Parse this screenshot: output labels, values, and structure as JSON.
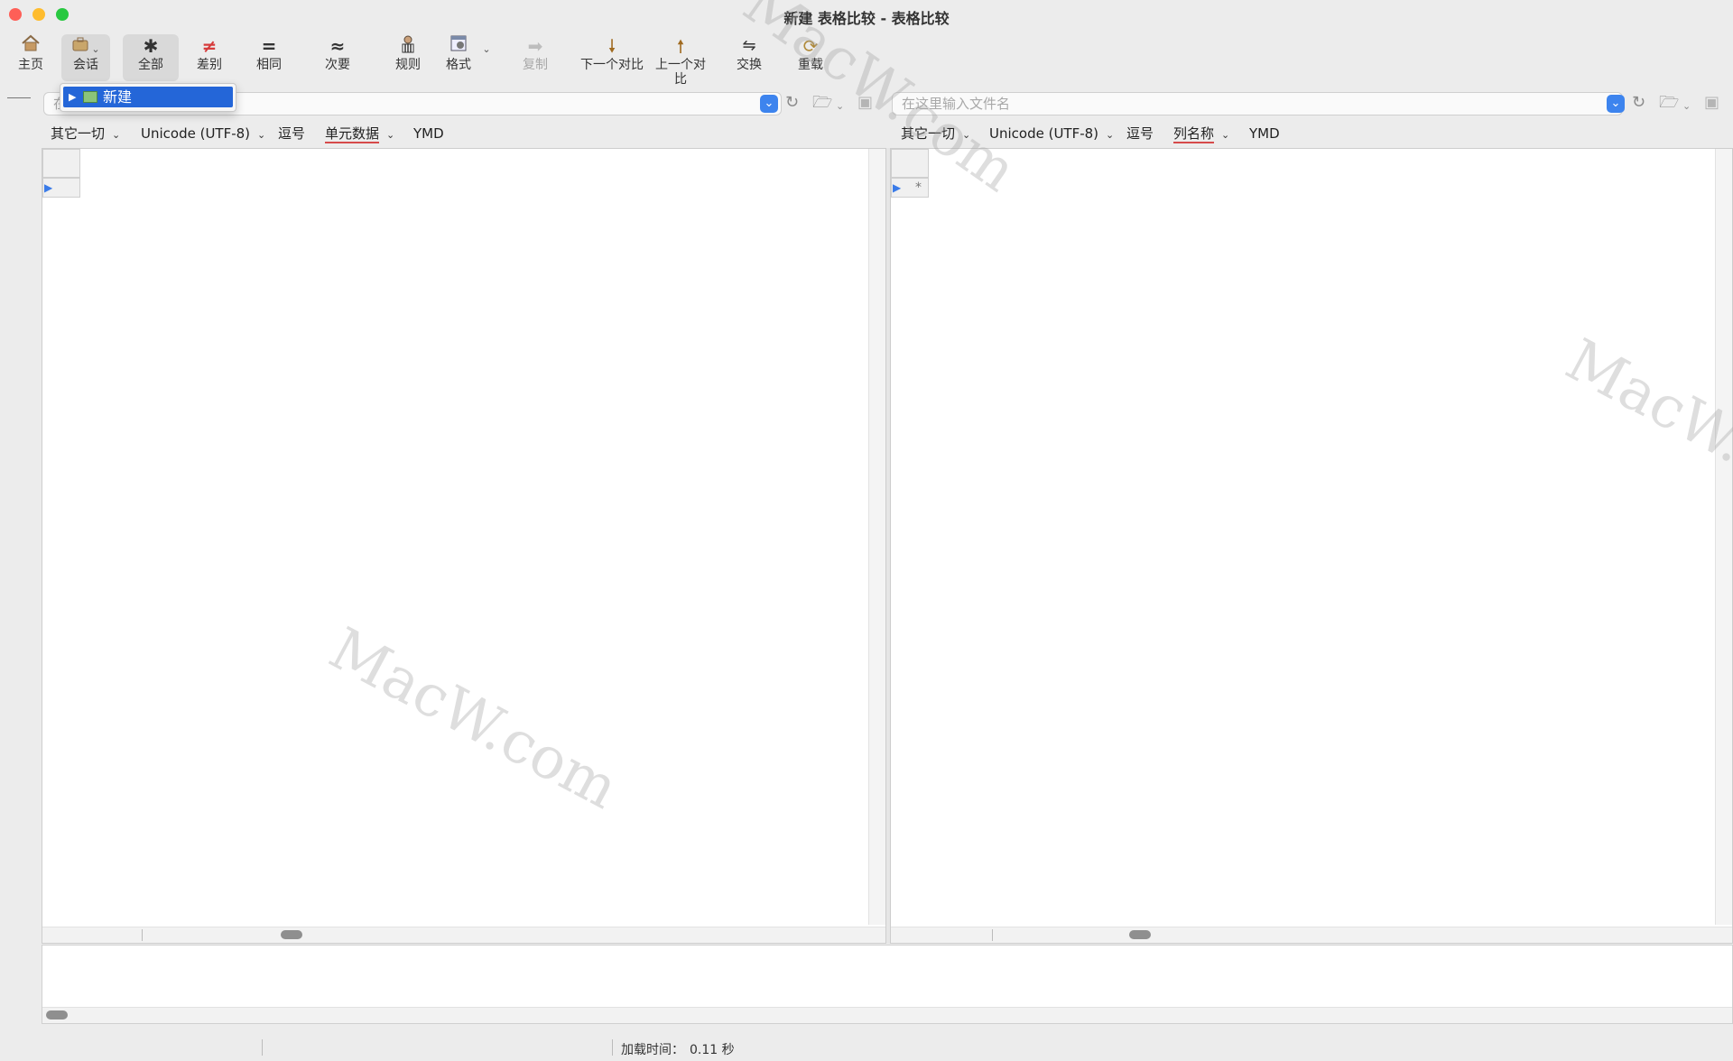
{
  "window": {
    "title": "新建 表格比较 - 表格比较"
  },
  "toolbar": {
    "home": "主页",
    "session": "会话",
    "all": "全部",
    "diffs": "差别",
    "same": "相同",
    "minor": "次要",
    "rules": "规则",
    "format": "格式",
    "copy": "复制",
    "next_diff": "下一个对比",
    "prev_diff": "上一个对比",
    "swap": "交换",
    "reload": "重载"
  },
  "session_menu": {
    "item": "新建"
  },
  "left": {
    "path_placeholder": "在这里输入文件名",
    "options": [
      "其它一切",
      "Unicode (UTF-8)",
      "逗号",
      "单元数据",
      "YMD"
    ]
  },
  "right": {
    "path_placeholder": "在这里输入文件名",
    "options": [
      "其它一切",
      "Unicode (UTF-8)",
      "逗号",
      "列名称",
      "YMD"
    ],
    "new_row_marker": "*"
  },
  "status": {
    "label": "加载时间：",
    "value": "0.11 秒"
  },
  "watermark": "MacW.com",
  "colors": {
    "accent": "#3d84ee",
    "selection": "#2466d8",
    "diff_underline": "#d64a4a"
  }
}
